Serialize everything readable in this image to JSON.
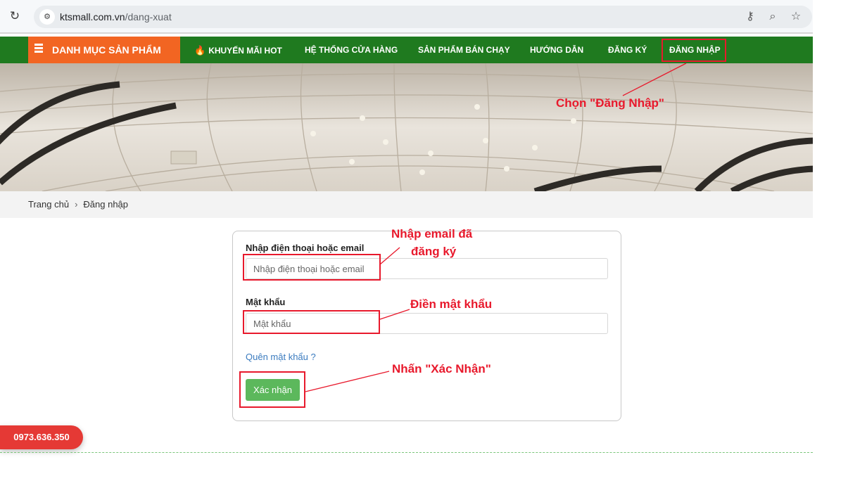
{
  "browser": {
    "url_host": "ktsmall.com.vn",
    "url_path": "/dang-xuat"
  },
  "navbar": {
    "category_label": "DANH MỤC SẢN PHẨM",
    "items": [
      {
        "label": "KHUYẾN MÃI HOT"
      },
      {
        "label": "HỆ THỐNG CỬA HÀNG"
      },
      {
        "label": "SẢN PHẨM BÁN CHẠY"
      },
      {
        "label": "HƯỚNG DẪN"
      },
      {
        "label": "ĐĂNG KÝ"
      },
      {
        "label": "ĐĂNG NHẬP"
      }
    ]
  },
  "breadcrumb": {
    "home": "Trang chủ",
    "separator": "›",
    "current": "Đăng nhập"
  },
  "login": {
    "account_label": "Nhập điện thoại hoặc email",
    "account_placeholder": "Nhập điện thoại hoặc email",
    "password_label": "Mật khẩu",
    "password_placeholder": "Mật khẩu",
    "forgot_link": "Quên mật khẩu ?",
    "submit_label": "Xác nhận"
  },
  "annotations": {
    "login_menu": "Chọn \"Đăng Nhập\"",
    "email_line1": "Nhập email đã",
    "email_line2": "đăng ký",
    "password": "Điền mật khẩu",
    "submit": "Nhấn \"Xác Nhận\""
  },
  "contact": {
    "phone": "0973.636.350"
  },
  "colors": {
    "nav_green": "#1f7a1f",
    "category_orange": "#f26522",
    "annotation_red": "#e8192c",
    "button_green": "#5cb85c",
    "phone_red": "#e53935"
  }
}
